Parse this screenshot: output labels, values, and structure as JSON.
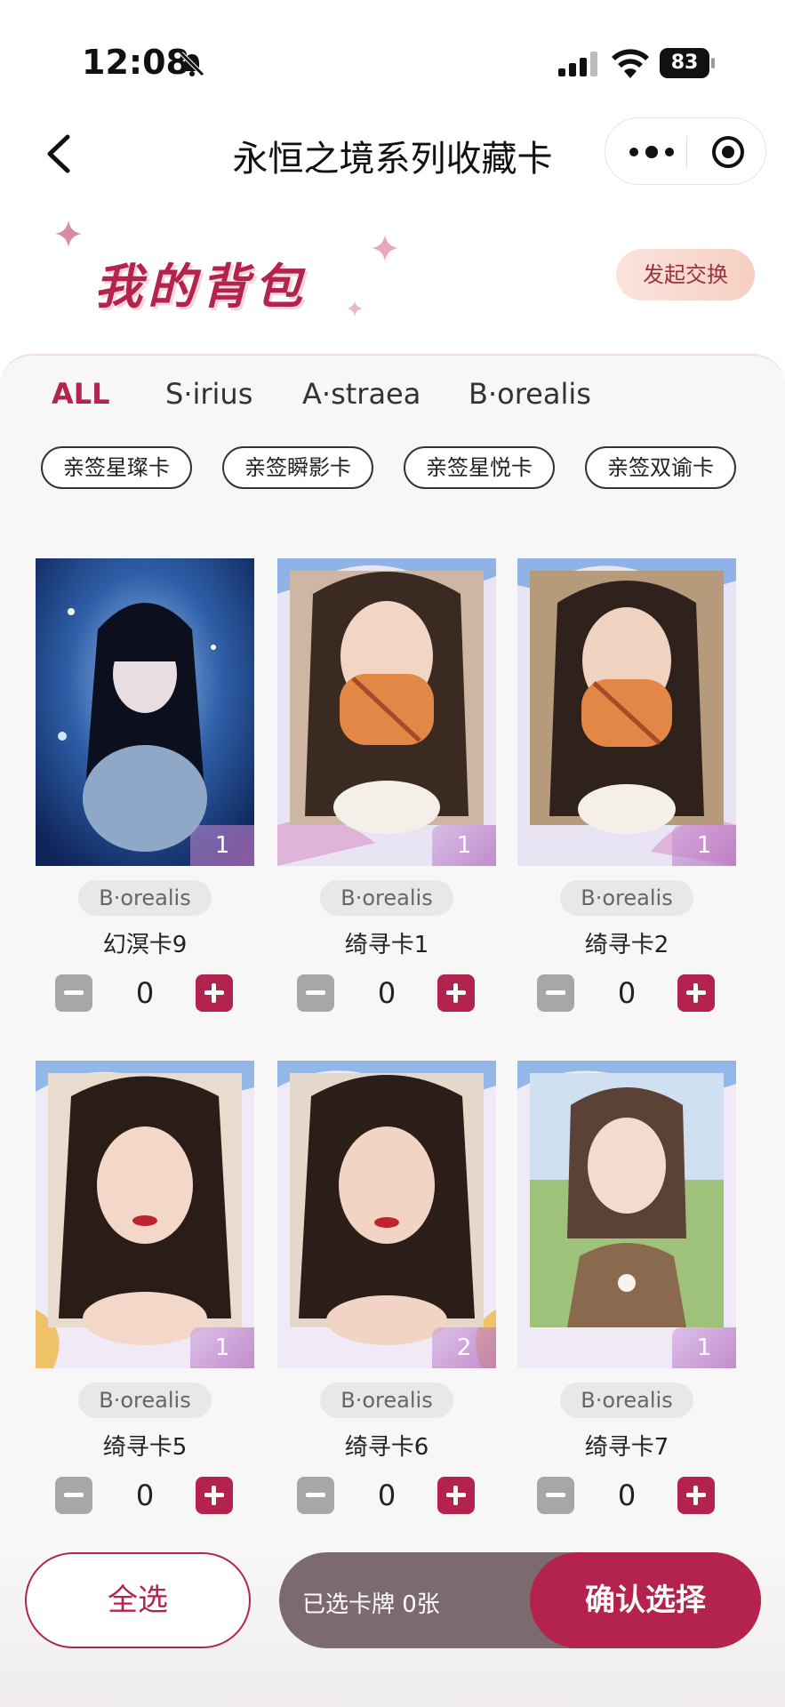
{
  "status_bar": {
    "time": "12:08",
    "battery": "83"
  },
  "nav": {
    "title": "永恒之境系列收藏卡"
  },
  "header": {
    "title": "我的背包",
    "exchange_label": "发起交换"
  },
  "tabs": [
    {
      "label": "ALL",
      "active": true
    },
    {
      "label": "S·irius",
      "active": false
    },
    {
      "label": "A·straea",
      "active": false
    },
    {
      "label": "B·orealis",
      "active": false
    }
  ],
  "chips": [
    "亲签星璨卡",
    "亲签瞬影卡",
    "亲签星悦卡",
    "亲签双谕卡"
  ],
  "cards": [
    {
      "name": "幻溟卡9",
      "tag": "B·orealis",
      "owned": "1",
      "selected": "0",
      "image": "dark-hair-blue-light-portrait"
    },
    {
      "name": "绮寻卡1",
      "tag": "B·orealis",
      "owned": "1",
      "selected": "0",
      "image": "long-hair-holding-orange-mask"
    },
    {
      "name": "绮寻卡2",
      "tag": "B·orealis",
      "owned": "1",
      "selected": "0",
      "image": "long-hair-holding-orange-mask"
    },
    {
      "name": "绮寻卡5",
      "tag": "B·orealis",
      "owned": "1",
      "selected": "0",
      "image": "dark-hair-red-lip-portrait"
    },
    {
      "name": "绮寻卡6",
      "tag": "B·orealis",
      "owned": "2",
      "selected": "0",
      "image": "dark-hair-red-lip-portrait"
    },
    {
      "name": "绮寻卡7",
      "tag": "B·orealis",
      "owned": "1",
      "selected": "0",
      "image": "braided-hair-outdoor-portrait"
    }
  ],
  "footer": {
    "select_all_label": "全选",
    "selected_text": "已选卡牌 0张",
    "confirm_label": "确认选择"
  },
  "colors": {
    "accent": "#b3234e",
    "tab_active": "#b3234e"
  }
}
